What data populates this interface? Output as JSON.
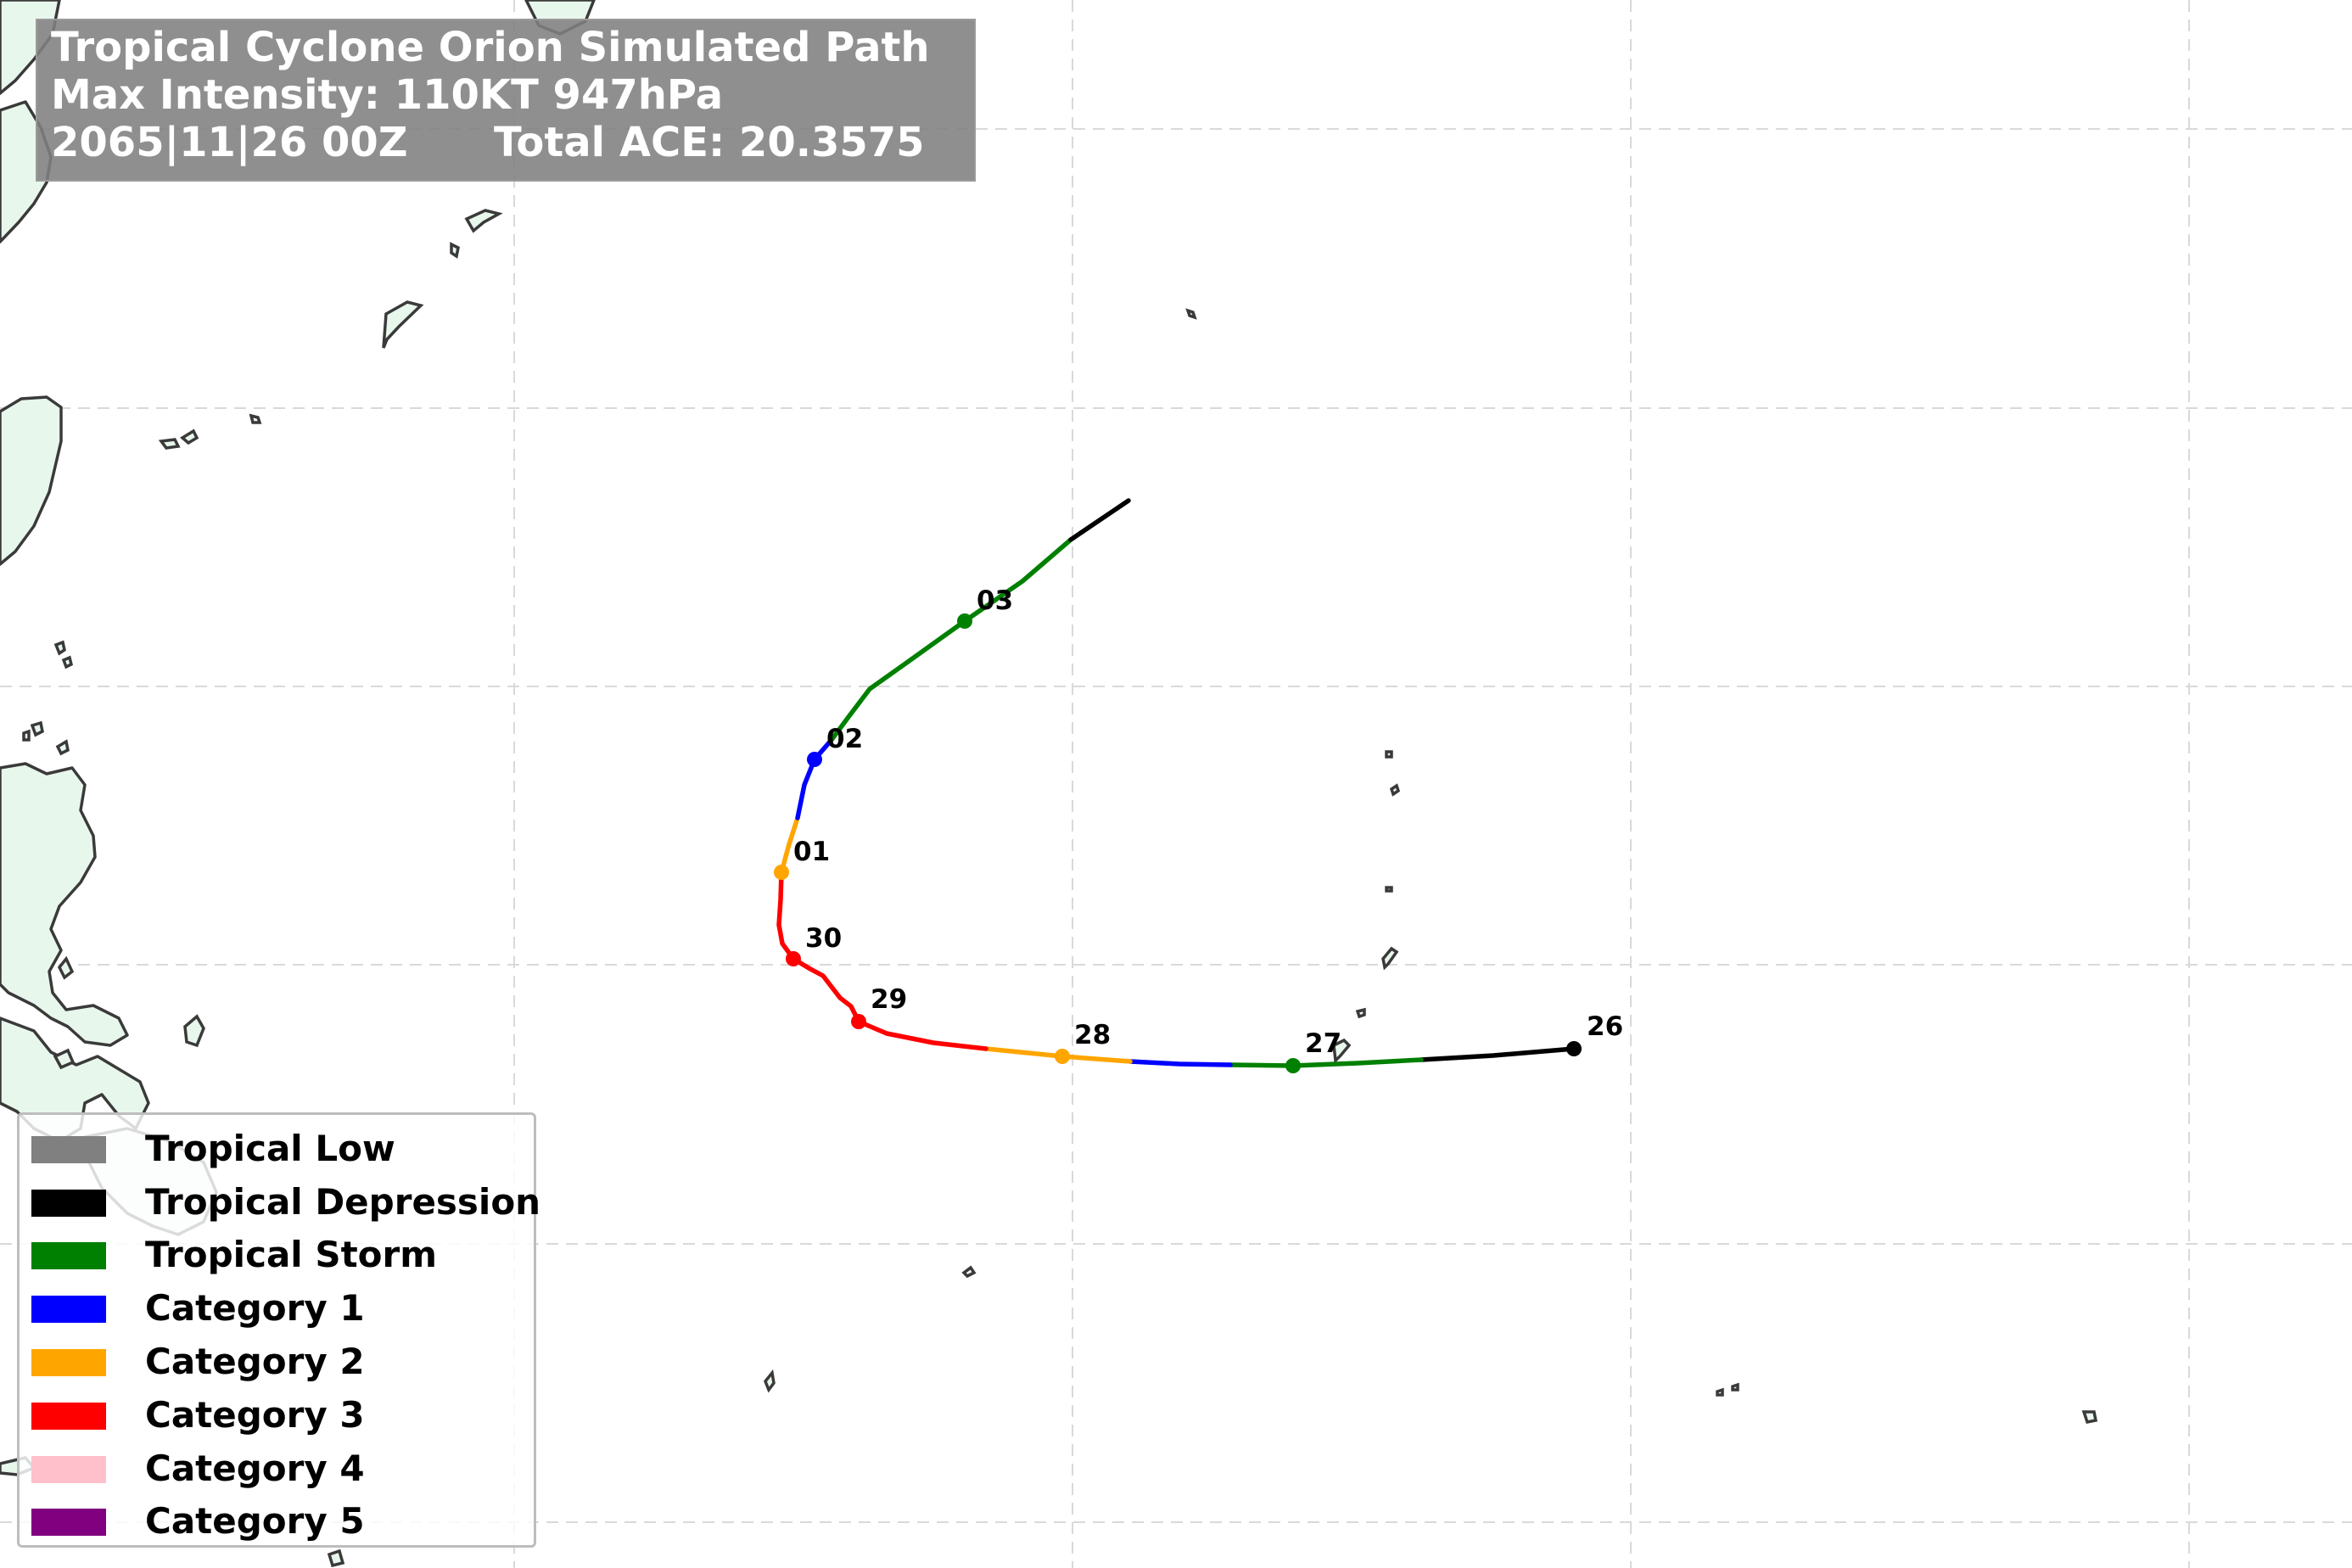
{
  "title": {
    "line1": "Tropical Cyclone Orion Simulated Path",
    "line2": "Max Intensity: 110KT 947hPa",
    "line3_date": "2065|11|26 00Z",
    "line3_ace": "Total ACE: 20.3575"
  },
  "legend": {
    "items": [
      {
        "label": "Tropical Low",
        "color": "#808080"
      },
      {
        "label": "Tropical Depression",
        "color": "#000000"
      },
      {
        "label": "Tropical Storm",
        "color": "#008000"
      },
      {
        "label": "Category 1",
        "color": "#0000ff"
      },
      {
        "label": "Category 2",
        "color": "#ffa500"
      },
      {
        "label": "Category 3",
        "color": "#ff0000"
      },
      {
        "label": "Category 4",
        "color": "#ffc0cb"
      },
      {
        "label": "Category 5",
        "color": "#800080"
      }
    ]
  },
  "track": {
    "day_markers": [
      {
        "label": "26",
        "color": "#000000"
      },
      {
        "label": "27",
        "color": "#008000"
      },
      {
        "label": "28",
        "color": "#ffa500"
      },
      {
        "label": "29",
        "color": "#ff0000"
      },
      {
        "label": "30",
        "color": "#ff0000"
      },
      {
        "label": "01",
        "color": "#ffa500"
      },
      {
        "label": "02",
        "color": "#0000ff"
      },
      {
        "label": "03",
        "color": "#008000"
      }
    ]
  },
  "map": {
    "land_color": "#e8f7ec",
    "coastline_color": "#3a3a3a",
    "gridline_color": "#d9d9d9"
  }
}
